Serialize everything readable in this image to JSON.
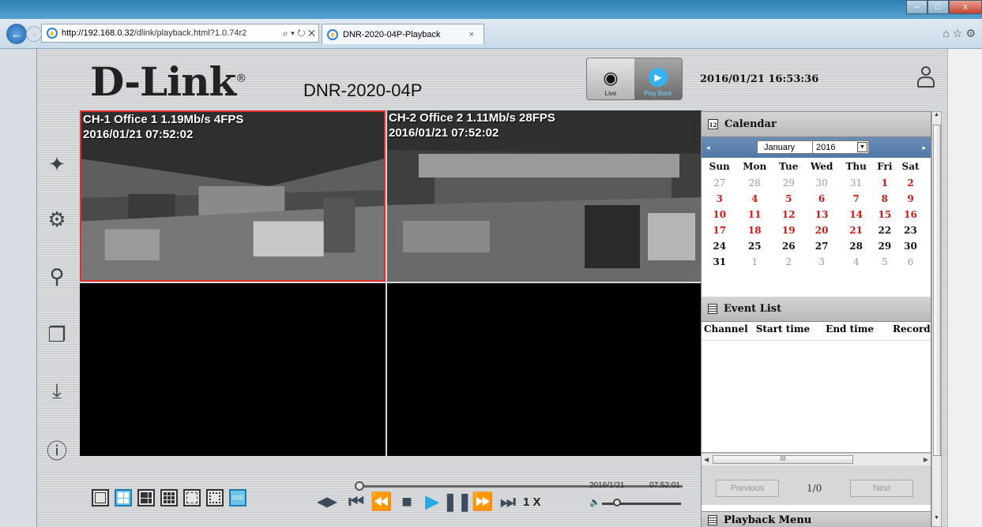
{
  "browser": {
    "url_host": "http://192.168.0.32",
    "url_path": "/dlink/playback.html?1.0.74r2",
    "url_controls": "⌕ ▾ ↻ ✕",
    "tab_title": "DNR-2020-04P-Playback",
    "tab_close": "×",
    "win_min": "–",
    "win_max": "□",
    "win_close": "x",
    "right_icons": "⌂☆⚙"
  },
  "header": {
    "logo": "D-Link",
    "logo_reg": "®",
    "model": "DNR-2020-04P",
    "live_label": "Live",
    "playback_label": "Play Back",
    "datetime": "2016/01/21 16:53:36"
  },
  "cameras": [
    {
      "line1": "CH-1 Office 1 1.19Mb/s 4FPS",
      "line2": "2016/01/21 07:52:02"
    },
    {
      "line1": "CH-2 Office 2 1.11Mb/s 28FPS",
      "line2": "2016/01/21 07:52:02"
    }
  ],
  "calendar": {
    "title": "Calendar",
    "month": "January",
    "year": "2016",
    "prev": "◂",
    "next": "▸",
    "weekdays": [
      "Sun",
      "Mon",
      "Tue",
      "Wed",
      "Thu",
      "Fri",
      "Sat"
    ],
    "weeks": [
      [
        "27",
        "28",
        "29",
        "30",
        "31",
        "1",
        "2"
      ],
      [
        "3",
        "4",
        "5",
        "6",
        "7",
        "8",
        "9"
      ],
      [
        "10",
        "11",
        "12",
        "13",
        "14",
        "15",
        "16"
      ],
      [
        "17",
        "18",
        "19",
        "20",
        "21",
        "22",
        "23"
      ],
      [
        "24",
        "25",
        "26",
        "27",
        "28",
        "29",
        "30"
      ],
      [
        "31",
        "1",
        "2",
        "3",
        "4",
        "5",
        "6"
      ]
    ]
  },
  "events": {
    "title": "Event List",
    "columns": [
      "Channel",
      "Start time",
      "End time",
      "Record ty"
    ],
    "prev": "Previous",
    "next": "Next",
    "count": "1/0",
    "scroll_grip": "III"
  },
  "playback_menu": "Playback Menu",
  "controls": {
    "speed": "1 X",
    "date": "2016/1/21",
    "time": "07:52:01"
  },
  "colors": {
    "accent": "#2ba8e0",
    "selected_border": "#e2312a",
    "weekday_red": "#d21616"
  }
}
